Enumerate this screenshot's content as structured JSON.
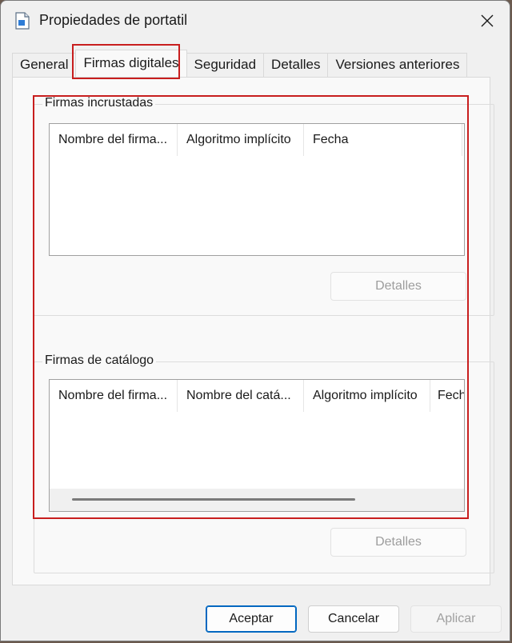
{
  "window": {
    "title": "Propiedades de portatil"
  },
  "tabs": [
    {
      "label": "General",
      "active": false
    },
    {
      "label": "Firmas digitales",
      "active": true
    },
    {
      "label": "Seguridad",
      "active": false
    },
    {
      "label": "Detalles",
      "active": false
    },
    {
      "label": "Versiones anteriores",
      "active": false
    }
  ],
  "embedded": {
    "legend": "Firmas incrustadas",
    "columns": [
      "Nombre del firma...",
      "Algoritmo implícito",
      "Fecha"
    ],
    "details_button": "Detalles"
  },
  "catalog": {
    "legend": "Firmas de catálogo",
    "columns": [
      "Nombre del firma...",
      "Nombre del catá...",
      "Algoritmo implícito",
      "Fech"
    ],
    "details_button": "Detalles"
  },
  "footer": {
    "ok": "Aceptar",
    "cancel": "Cancelar",
    "apply": "Aplicar"
  },
  "colors": {
    "highlight": "#c81e1e",
    "accent": "#0067c0",
    "disabled_text": "#9d9d9d"
  }
}
